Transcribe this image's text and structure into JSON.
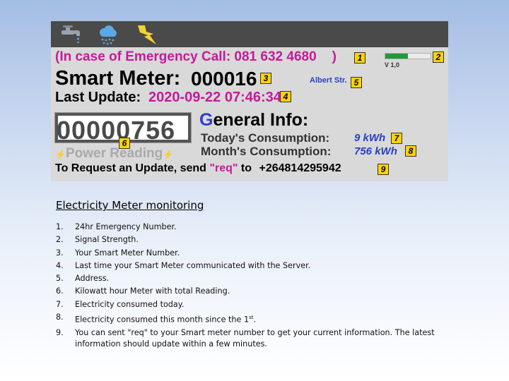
{
  "meter": {
    "emergency_text": "(In case of Emergency Call:  081 632 4680",
    "emergency_close": ")",
    "signal_level": 0.5,
    "version": "V 1,0",
    "smart_meter_label": "Smart Meter:",
    "smart_meter_number": "000016",
    "address": "Albert Str.",
    "last_update_label": "Last Update:",
    "last_update_value": "2020-09-22 07:46:34",
    "reading_value": "00000756",
    "power_reading_label": "Power Reading",
    "general_info_first": "G",
    "general_info_rest": "eneral Info:",
    "today_label": "Today's Consumption:",
    "today_value": "9 kWh",
    "month_label": "Month's Consumption:",
    "month_value": "756 kWh",
    "request_prefix": "To Request an Update, send ",
    "request_keyword": "\"req\"",
    "request_middle": " to ",
    "request_number": "+264814295942",
    "badges": [
      "1",
      "2",
      "3",
      "4",
      "5",
      "6",
      "7",
      "8",
      "9"
    ],
    "icons": [
      "water-tap-icon",
      "rain-cloud-icon",
      "lightning-bolt-icon"
    ],
    "colors": {
      "emergency": "#c61a9a",
      "blue": "#2a3fc8",
      "badge": "#ffd400",
      "signal": "#1f9a3a",
      "bar": "#4a4a4a"
    }
  },
  "notes": {
    "title": "Electricity Meter monitoring",
    "items": [
      {
        "num": "1.",
        "text": "24hr Emergency Number."
      },
      {
        "num": "2.",
        "text": "Signal Strength."
      },
      {
        "num": "3.",
        "text": "Your Smart Meter Number."
      },
      {
        "num": "4.",
        "text": "Last time your Smart Meter communicated with the Server."
      },
      {
        "num": "5.",
        "text": "Address."
      },
      {
        "num": "6.",
        "text": "Kilowatt hour  Meter with total Reading."
      },
      {
        "num": "7.",
        "text": "Electricity consumed today."
      },
      {
        "num": "8.",
        "text": "Electricity consumed this month since the 1",
        "sup": "st",
        "tail": "."
      },
      {
        "num": "9.",
        "text": "You can sent \"req\" to your Smart meter number to get your current information.  The latest information should update within a few minutes."
      }
    ]
  }
}
